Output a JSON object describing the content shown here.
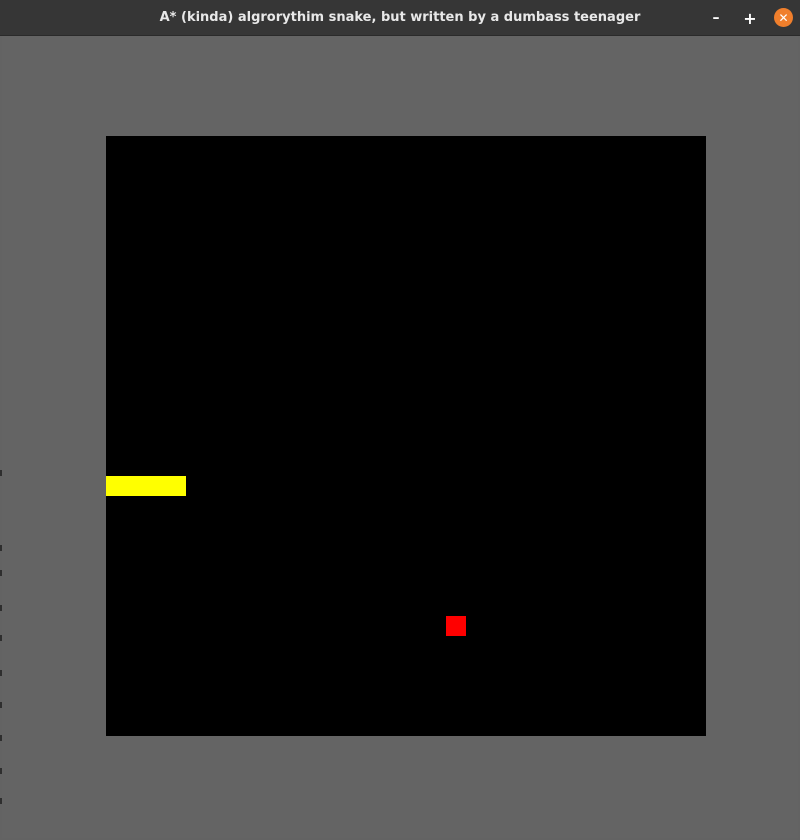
{
  "window": {
    "title": "A* (kinda) algrorythim snake, but written by a dumbass teenager",
    "controls": {
      "minimize_icon": "minimize-icon",
      "maximize_icon": "maximize-icon",
      "close_icon": "close-icon",
      "minimize_glyph": "–",
      "maximize_glyph": "+",
      "close_glyph": "✕"
    }
  },
  "colors": {
    "background": "#646464",
    "board": "#000000",
    "snake": "#ffff00",
    "food": "#ff0000",
    "close_button": "#f07f2c"
  },
  "game": {
    "grid_columns": 30,
    "grid_rows": 30,
    "snake": [
      {
        "col": 0,
        "row": 17
      },
      {
        "col": 1,
        "row": 17
      },
      {
        "col": 2,
        "row": 17
      },
      {
        "col": 3,
        "row": 17
      }
    ],
    "food": {
      "col": 17,
      "row": 24
    }
  }
}
